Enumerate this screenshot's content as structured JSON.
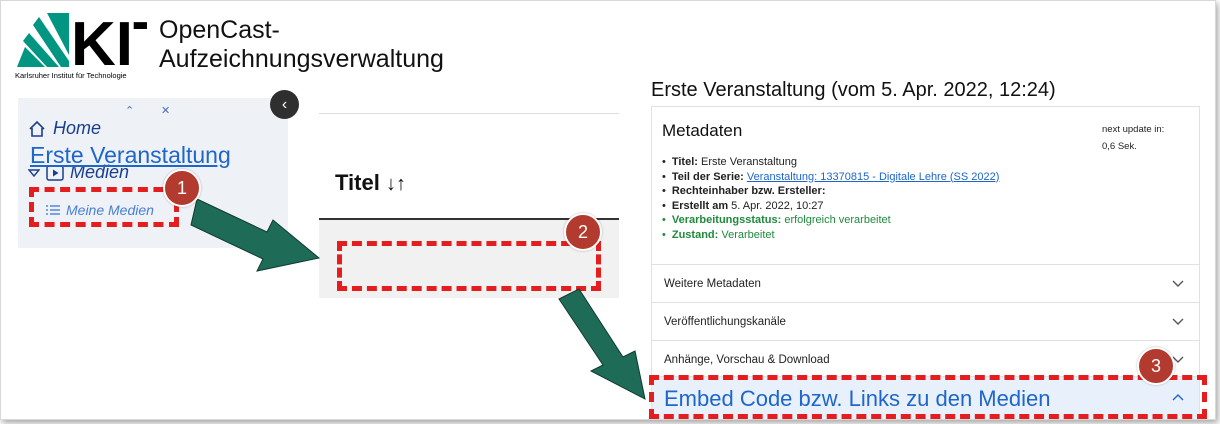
{
  "header": {
    "logo_text": "KIT",
    "logo_subtitle": "Karlsruher Institut für Technologie",
    "app_title_line1": "OpenCast-",
    "app_title_line2": "Aufzeichnungsverwaltung"
  },
  "sidebar": {
    "home_label": "Home",
    "medien_label": "Medien",
    "meine_medien_label": "Meine Medien",
    "expand_glyph": "⌃",
    "collapse_glyph": "⌄",
    "collapse_button_glyph": "‹"
  },
  "table": {
    "column_header": "Titel",
    "sort_glyph": "↓↑",
    "row_title": "Erste Veranstaltung"
  },
  "event": {
    "title": "Erste Veranstaltung (vom 5. Apr. 2022, 12:24)",
    "metadata_heading": "Metadaten",
    "next_update_line1": "next update in:",
    "next_update_line2": "0,6 Sek.",
    "fields": [
      {
        "key": "Titel:",
        "value": "Erste Veranstaltung"
      },
      {
        "key": "Teil der Serie:",
        "value": "Veranstaltung: 13370815 - Digitale Lehre (SS 2022)"
      },
      {
        "key": "Rechteinhaber bzw. Ersteller:",
        "value": ""
      },
      {
        "key": "Erstellt am",
        "value": "5. Apr. 2022, 10:27"
      },
      {
        "key": "Verarbeitungsstatus:",
        "value": "erfolgreich verarbeitet"
      },
      {
        "key": "Zustand:",
        "value": "Verarbeitet"
      }
    ],
    "accordions": [
      {
        "label": "Weitere Metadaten",
        "open": false
      },
      {
        "label": "Veröffentlichungskanäle",
        "open": false
      },
      {
        "label": "Anhänge, Vorschau & Download",
        "open": false
      },
      {
        "label": "Embed Code bzw. Links zu den Medien",
        "open": true
      }
    ]
  },
  "steps": [
    "1",
    "2",
    "3"
  ],
  "colors": {
    "highlight": "#e41e1e",
    "badge": "#b23a2e",
    "arrow": "#1e6b57",
    "link": "#1e66c9",
    "status_ok": "#1f8a3c"
  }
}
